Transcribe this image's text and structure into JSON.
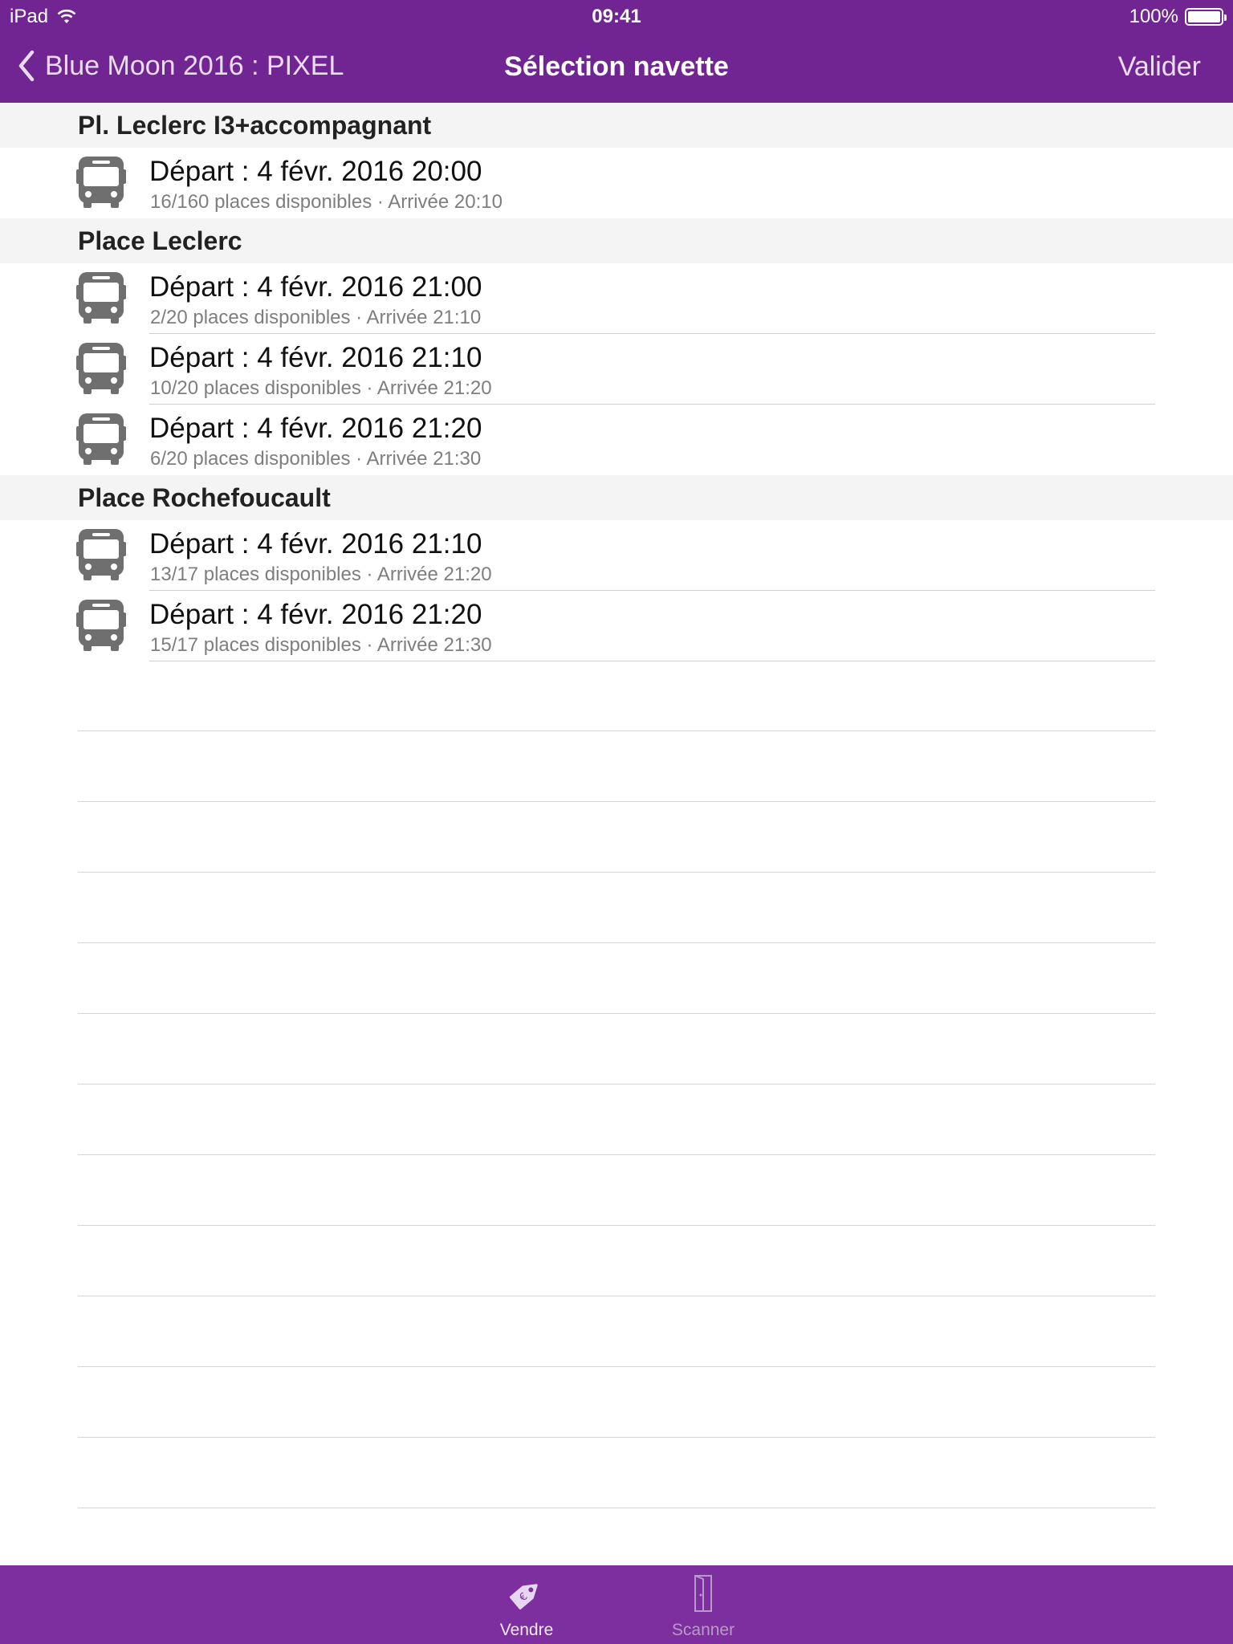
{
  "status_bar": {
    "device": "iPad",
    "time": "09:41",
    "battery": "100%",
    "battery_level": 1.0
  },
  "nav": {
    "back_label": "Blue Moon 2016 : PIXEL",
    "title": "Sélection navette",
    "validate_label": "Valider"
  },
  "sections": [
    {
      "header": "Pl. Leclerc I3+accompagnant",
      "rows": [
        {
          "title": "Départ : 4 févr. 2016 20:00",
          "subtitle": "16/160 places disponibles · Arrivée 20:10"
        }
      ]
    },
    {
      "header": "Place Leclerc",
      "rows": [
        {
          "title": "Départ : 4 févr. 2016 21:00",
          "subtitle": "2/20 places disponibles · Arrivée 21:10"
        },
        {
          "title": "Départ : 4 févr. 2016 21:10",
          "subtitle": "10/20 places disponibles · Arrivée 21:20"
        },
        {
          "title": "Départ : 4 févr. 2016 21:20",
          "subtitle": "6/20 places disponibles · Arrivée 21:30"
        }
      ]
    },
    {
      "header": "Place Rochefoucault",
      "rows": [
        {
          "title": "Départ : 4 févr. 2016 21:10",
          "subtitle": "13/17 places disponibles · Arrivée 21:20"
        },
        {
          "title": "Départ : 4 févr. 2016 21:20",
          "subtitle": "15/17 places disponibles · Arrivée 21:30"
        }
      ]
    }
  ],
  "tab_bar": {
    "tabs": [
      {
        "label": "Vendre",
        "icon": "price-tag-icon",
        "active": true
      },
      {
        "label": "Scanner",
        "icon": "door-icon",
        "active": false
      }
    ]
  },
  "colors": {
    "nav_background": "#702592",
    "tab_background": "#7d2fa0",
    "section_background": "#f4f4f4",
    "icon_gray": "#6f6f6f"
  }
}
